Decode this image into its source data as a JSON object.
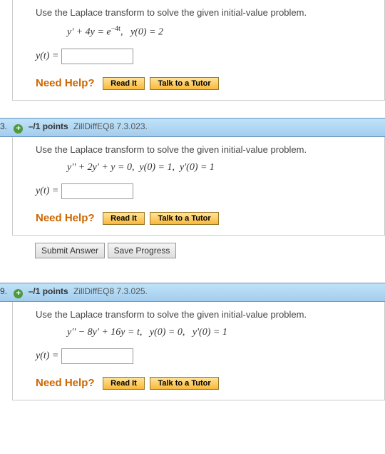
{
  "q1": {
    "prompt": "Use the Laplace transform to solve the given initial-value problem.",
    "eq_html": "y' + 4y = e<sup>−4t</sup>,&nbsp;&nbsp;&nbsp;y(0) = 2",
    "answer_label": "y(t) =",
    "answer_value": ""
  },
  "help": {
    "label": "Need Help?",
    "read": "Read It",
    "tutor": "Talk to a Tutor"
  },
  "q2": {
    "marker": "3.",
    "points": "–/1 points",
    "ref": "ZillDiffEQ8 7.3.023.",
    "prompt": "Use the Laplace transform to solve the given initial-value problem.",
    "eq_html": "y'' + 2y' + y = 0,&nbsp;&nbsp;y(0) = 1,&nbsp;&nbsp;y'(0) = 1",
    "answer_label": "y(t) =",
    "answer_value": ""
  },
  "buttons": {
    "submit": "Submit Answer",
    "save": "Save Progress"
  },
  "q3": {
    "marker": "9.",
    "points": "–/1 points",
    "ref": "ZillDiffEQ8 7.3.025.",
    "prompt": "Use the Laplace transform to solve the given initial-value problem.",
    "eq_html": "y'' − 8y' + 16y = t,&nbsp;&nbsp;&nbsp;y(0) = 0,&nbsp;&nbsp;&nbsp;y'(0) = 1",
    "answer_label": "y(t) =",
    "answer_value": ""
  }
}
